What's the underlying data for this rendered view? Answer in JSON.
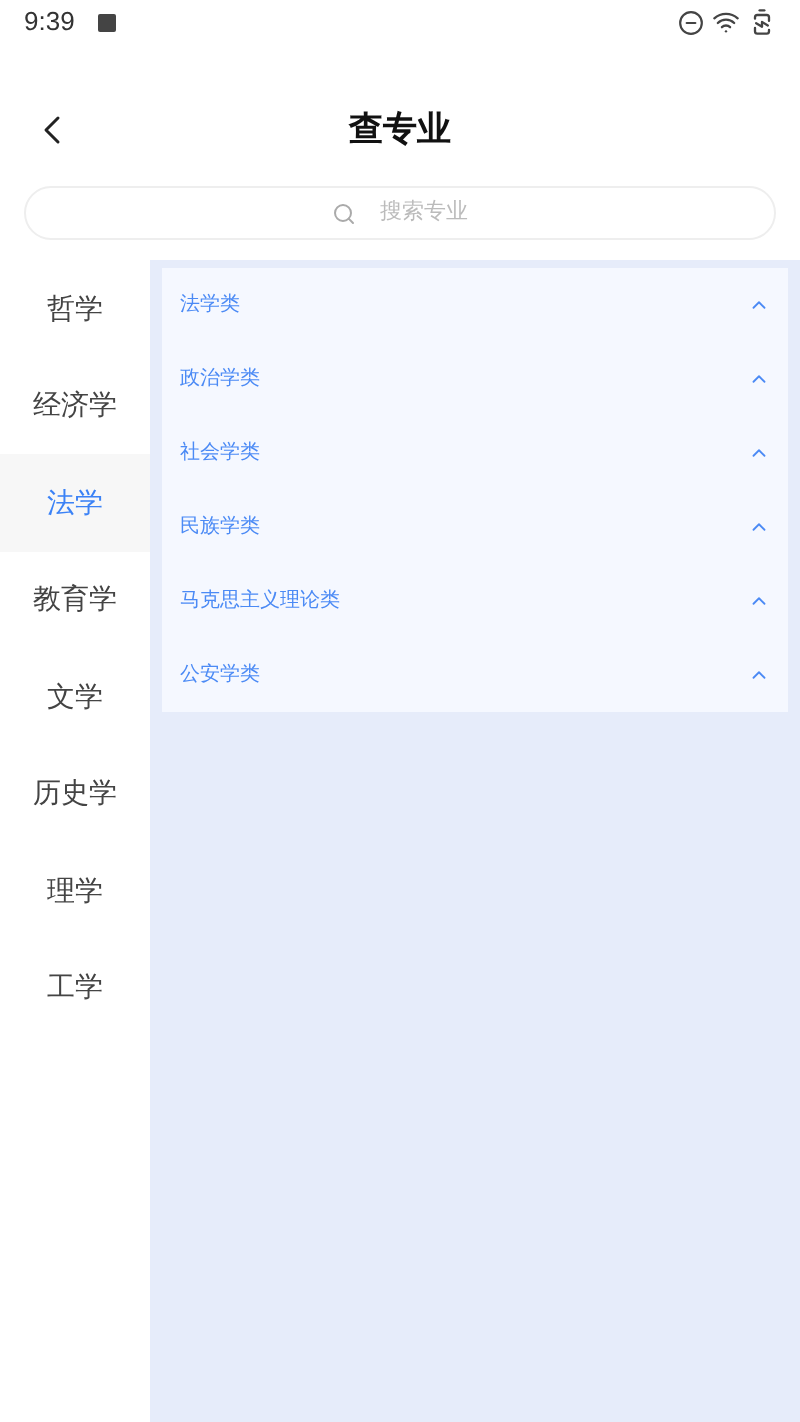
{
  "status_bar": {
    "time": "9:39"
  },
  "header": {
    "title": "查专业"
  },
  "search": {
    "placeholder": "搜索专业"
  },
  "sidebar": {
    "items": [
      {
        "label": "哲学",
        "selected": false
      },
      {
        "label": "经济学",
        "selected": false
      },
      {
        "label": "法学",
        "selected": true
      },
      {
        "label": "教育学",
        "selected": false
      },
      {
        "label": "文学",
        "selected": false
      },
      {
        "label": "历史学",
        "selected": false
      },
      {
        "label": "理学",
        "selected": false
      },
      {
        "label": "工学",
        "selected": false
      }
    ]
  },
  "categories": [
    {
      "label": "法学类"
    },
    {
      "label": "政治学类"
    },
    {
      "label": "社会学类"
    },
    {
      "label": "民族学类"
    },
    {
      "label": "马克思主义理论类"
    },
    {
      "label": "公安学类"
    }
  ]
}
